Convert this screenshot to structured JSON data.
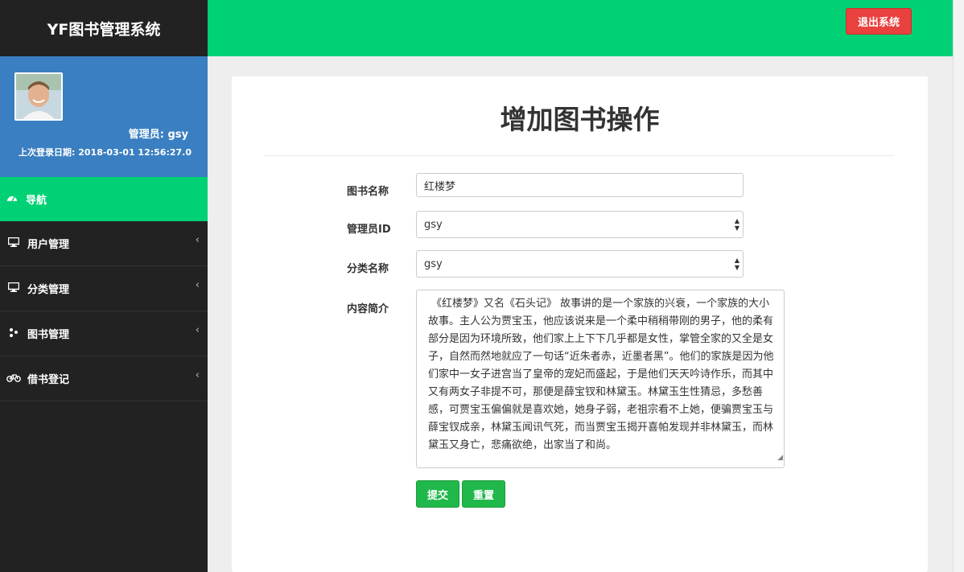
{
  "sidebar": {
    "brand": "YF图书管理系统",
    "admin_label": "管理员: gsy",
    "last_login": "上次登录日期: 2018-03-01 12:56:27.0",
    "nav_header": "导航",
    "items": [
      {
        "label": "用户管理",
        "icon": "monitor-icon"
      },
      {
        "label": "分类管理",
        "icon": "monitor-icon"
      },
      {
        "label": "图书管理",
        "icon": "share-icon"
      },
      {
        "label": "借书登记",
        "icon": "bicycle-icon"
      }
    ]
  },
  "header": {
    "logout_label": "退出系统"
  },
  "form": {
    "title": "增加图书操作",
    "book_name_label": "图书名称",
    "book_name_value": "红楼梦",
    "admin_id_label": "管理员ID",
    "admin_id_value": "gsy",
    "category_label": "分类名称",
    "category_value": "gsy",
    "summary_label": "内容简介",
    "summary_value": "《红楼梦》又名《石头记》 故事讲的是一个家族的兴衰，一个家族的大小故事。主人公为贾宝玉，他应该说来是一个柔中稍稍带刚的男子，他的柔有部分是因为环境所致，他们家上上下下几乎都是女性，掌管全家的又全是女子，自然而然地就应了一句话“近朱者赤，近墨者黑”。他们的家族是因为他们家中一女子进宫当了皇帝的宠妃而盛起，于是他们天天吟诗作乐，而其中又有两女子非提不可，那便是薛宝钗和林黛玉。林黛玉生性猜忌，多愁善感，可贾宝玉偏偏就是喜欢她，她身子弱，老祖宗看不上她，便骗贾宝玉与薛宝钗成亲，林黛玉闻讯气死，而当贾宝玉揭开喜帕发现并非林黛玉，而林黛玉又身亡，悲痛欲绝，出家当了和尚。",
    "submit_label": "提交",
    "reset_label": "重置"
  },
  "colors": {
    "green": "#00d175",
    "blue": "#3a7fc1",
    "dark": "#222222",
    "danger": "#e8413e",
    "button_green": "#20b84a"
  }
}
